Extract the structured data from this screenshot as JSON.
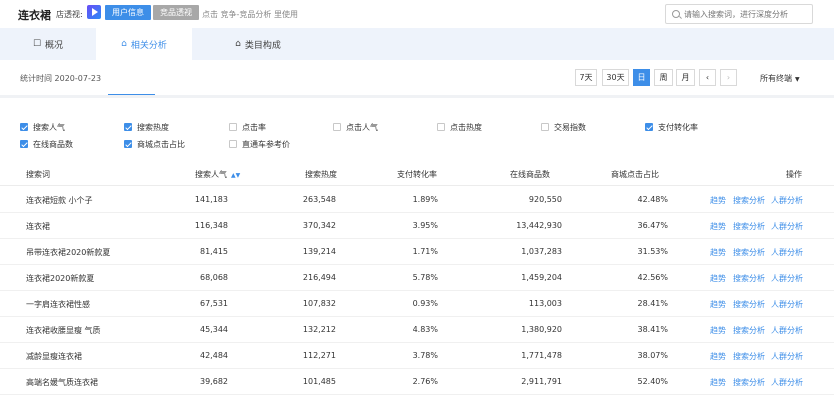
{
  "header": {
    "title": "连衣裙",
    "store_label": "店透视:",
    "user_info_btn": "用户信息",
    "competitor_btn": "竞品透视",
    "hint": "点击 竞争-竞品分析 里使用",
    "search_placeholder": "请输入搜索词，进行深度分析"
  },
  "tabs": [
    {
      "label": "概况",
      "icon": "☐"
    },
    {
      "label": "相关分析",
      "icon": "⌂"
    },
    {
      "label": "类目构成",
      "icon": "⌂"
    }
  ],
  "stats": {
    "time_label": "统计时间 2020-07-23",
    "periods": [
      "7天",
      "30天",
      "日",
      "周",
      "月"
    ],
    "active_period": "日",
    "prev": "‹",
    "next": "›",
    "terminal": "所有终端",
    "terminal_caret": "▼"
  },
  "checkboxes": [
    {
      "label": "搜索人气",
      "checked": true
    },
    {
      "label": "搜索热度",
      "checked": true
    },
    {
      "label": "点击率",
      "checked": false
    },
    {
      "label": "点击人气",
      "checked": false
    },
    {
      "label": "点击热度",
      "checked": false
    },
    {
      "label": "交易指数",
      "checked": false
    },
    {
      "label": "支付转化率",
      "checked": true
    },
    {
      "label": "在线商品数",
      "checked": true
    },
    {
      "label": "商城点击占比",
      "checked": true
    },
    {
      "label": "直通车参考价",
      "checked": false
    }
  ],
  "table": {
    "headers": [
      "搜索词",
      "搜索人气",
      "搜索热度",
      "支付转化率",
      "在线商品数",
      "商城点击占比",
      "操作"
    ],
    "sort_indicator": "▲▼",
    "actions": [
      "趋势",
      "搜索分析",
      "人群分析"
    ],
    "rows": [
      [
        "连衣裙短款 小个子",
        "141,183",
        "263,548",
        "1.89%",
        "920,550",
        "42.48%"
      ],
      [
        "连衣裙",
        "116,348",
        "370,342",
        "3.95%",
        "13,442,930",
        "36.47%"
      ],
      [
        "吊带连衣裙2020新款夏",
        "81,415",
        "139,214",
        "1.71%",
        "1,037,283",
        "31.53%"
      ],
      [
        "连衣裙2020新款夏",
        "68,068",
        "216,494",
        "5.78%",
        "1,459,204",
        "42.56%"
      ],
      [
        "一字肩连衣裙性感",
        "67,531",
        "107,832",
        "0.93%",
        "113,003",
        "28.41%"
      ],
      [
        "连衣裙收腰显瘦 气质",
        "45,344",
        "132,212",
        "4.83%",
        "1,380,920",
        "38.41%"
      ],
      [
        "减龄显瘦连衣裙",
        "42,484",
        "112,271",
        "3.78%",
        "1,771,478",
        "38.07%"
      ],
      [
        "高端名媛气质连衣裙",
        "39,682",
        "101,485",
        "2.76%",
        "2,911,791",
        "52.40%"
      ]
    ]
  },
  "colors": {
    "accent": "#3d8ee8",
    "tab_band": "#eef3fb"
  }
}
